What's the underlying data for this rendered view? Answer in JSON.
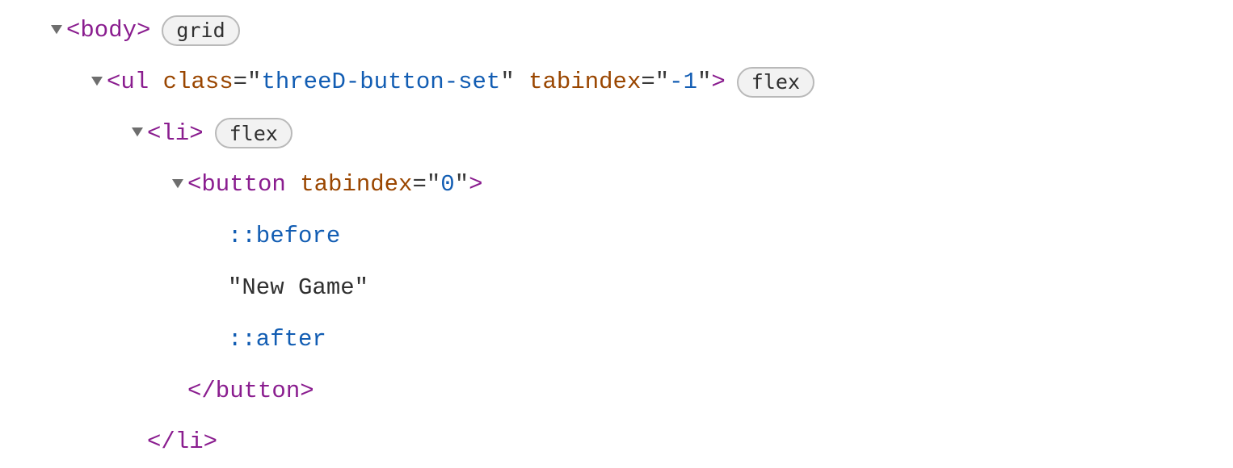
{
  "rows": [
    {
      "indent": 0,
      "arrow": true,
      "segments": [
        {
          "cls": "tag",
          "text": "<body>"
        }
      ],
      "badge": "grid"
    },
    {
      "indent": 1,
      "arrow": true,
      "segments": [
        {
          "cls": "tag",
          "text": "<ul "
        },
        {
          "cls": "attr",
          "text": "class"
        },
        {
          "cls": "eq",
          "text": "=\""
        },
        {
          "cls": "str",
          "text": "threeD-button-set"
        },
        {
          "cls": "eq",
          "text": "\" "
        },
        {
          "cls": "attr",
          "text": "tabindex"
        },
        {
          "cls": "eq",
          "text": "=\""
        },
        {
          "cls": "str",
          "text": "-1"
        },
        {
          "cls": "eq",
          "text": "\""
        },
        {
          "cls": "tag",
          "text": ">"
        }
      ],
      "badge": "flex"
    },
    {
      "indent": 2,
      "arrow": true,
      "segments": [
        {
          "cls": "tag",
          "text": "<li>"
        }
      ],
      "badge": "flex"
    },
    {
      "indent": 3,
      "arrow": true,
      "segments": [
        {
          "cls": "tag",
          "text": "<button "
        },
        {
          "cls": "attr",
          "text": "tabindex"
        },
        {
          "cls": "eq",
          "text": "=\""
        },
        {
          "cls": "str",
          "text": "0"
        },
        {
          "cls": "eq",
          "text": "\""
        },
        {
          "cls": "tag",
          "text": ">"
        }
      ]
    },
    {
      "indent": 4,
      "arrow": false,
      "segments": [
        {
          "cls": "pseudo",
          "text": "::before"
        }
      ]
    },
    {
      "indent": 4,
      "arrow": false,
      "segments": [
        {
          "cls": "text",
          "text": "\"New Game\""
        }
      ]
    },
    {
      "indent": 4,
      "arrow": false,
      "segments": [
        {
          "cls": "pseudo",
          "text": "::after"
        }
      ]
    },
    {
      "indent": 3,
      "arrow": false,
      "segments": [
        {
          "cls": "tag",
          "text": "</button>"
        }
      ]
    },
    {
      "indent": 2,
      "arrow": false,
      "segments": [
        {
          "cls": "tag",
          "text": "</li>"
        }
      ]
    }
  ]
}
